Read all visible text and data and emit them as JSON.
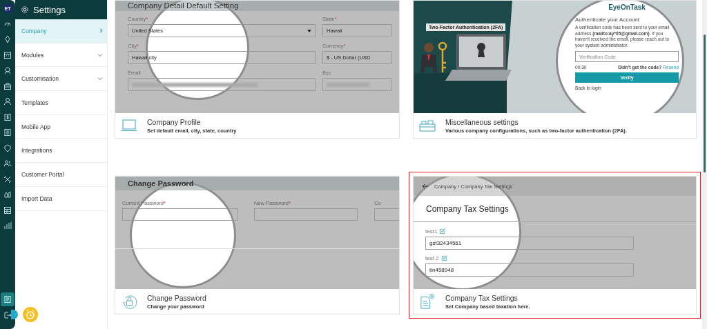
{
  "rail": {
    "logo": "ET"
  },
  "sidebar": {
    "title": "Settings",
    "items": [
      {
        "label": "Company",
        "selected": true,
        "kind": "page"
      },
      {
        "label": "Modules",
        "selected": false,
        "kind": "group"
      },
      {
        "label": "Customisation",
        "selected": false,
        "kind": "group"
      },
      {
        "label": "Templates",
        "selected": false,
        "kind": "page"
      },
      {
        "label": "Mobile App",
        "selected": false,
        "kind": "page"
      },
      {
        "label": "Integrations",
        "selected": false,
        "kind": "page"
      },
      {
        "label": "Customer Portal",
        "selected": false,
        "kind": "page"
      },
      {
        "label": "Import Data",
        "selected": false,
        "kind": "page"
      }
    ]
  },
  "cards": [
    {
      "kind": "profile",
      "title": "Company Profile",
      "description": "Set default email, city, state, country",
      "highlighted": false,
      "preview": {
        "heading": "Company Detail Default Setting",
        "fields": [
          {
            "label": "Country",
            "mark": "*",
            "value": "United States",
            "kind": "select"
          },
          {
            "label": "State",
            "mark": "*",
            "value": "Hawaii",
            "kind": "text"
          },
          {
            "label": "City",
            "mark": "*",
            "value": "Hawaii city",
            "kind": "text"
          },
          {
            "label": "Currency",
            "mark": "*",
            "value": "$ - US Dollar (USD",
            "kind": "text"
          },
          {
            "label": "Email",
            "kind": "blurred"
          },
          {
            "label": "Bcc",
            "kind": "blurred"
          }
        ]
      }
    },
    {
      "kind": "misc",
      "title": "Miscellaneous settings",
      "description": "Various company configurations, such as two-factor authentication (2FA).",
      "highlighted": false,
      "preview": {
        "banner": "Two-Factor Authentication (2FA)",
        "brand": "EyeOnTask",
        "heading": "Authenticate your Account",
        "message": "A verification code has been sent to your email address **(mailto:ay*****05@gmail.com)**. If you haven't received the email, please reach out to your system administrator.",
        "placeholder": "Verification Code",
        "timer": "00:30",
        "resend_prompt": "Didn't get the code?",
        "resend_link": "Resend",
        "button": "Verify",
        "back_link": "Back to login"
      }
    },
    {
      "kind": "password",
      "title": "Change Password",
      "description": "Change your password",
      "highlighted": false,
      "preview": {
        "heading": "Change Password",
        "fields": [
          {
            "label": "Current Password",
            "mark": "*"
          },
          {
            "label": "New Password",
            "mark": "*"
          },
          {
            "label": "Co"
          }
        ]
      }
    },
    {
      "kind": "tax",
      "title": "Company Tax Settings",
      "description": "Set Company based taxation here.",
      "highlighted": true,
      "preview": {
        "breadcrumb": "Company / Company Tax Settings",
        "heading": "Company Tax Settings",
        "fields": [
          {
            "label": "test1",
            "value": "gst32434561"
          },
          {
            "label": "test 2",
            "value": "tin458948"
          }
        ]
      }
    }
  ]
}
